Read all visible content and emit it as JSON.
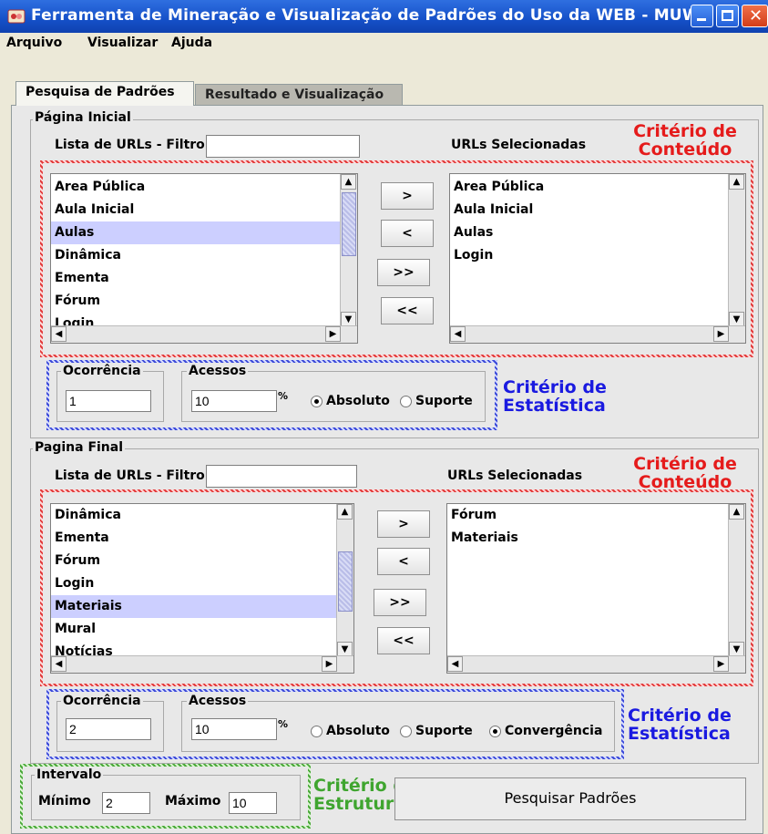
{
  "window": {
    "title": "Ferramenta de Mineração e Visualização de Padrões do Uso da WEB - MUW",
    "icon": "app-icon",
    "controls": [
      "minimize-icon",
      "maximize-icon",
      "close-icon"
    ]
  },
  "menu": [
    "Arquivo",
    "Visualizar",
    "Ajuda"
  ],
  "tabs": [
    {
      "label": "Pesquisa de Padrões",
      "active": true
    },
    {
      "label": "Resultado e Visualização",
      "active": false
    }
  ],
  "colors": {
    "red": "#e51b1b",
    "blue": "#1a1ae0",
    "green": "#3fa52f"
  },
  "inicial": {
    "group_label": "Página Inicial",
    "filter_label": "Lista de URLs - Filtro:",
    "filter_value": "",
    "selected_label": "URLs Selecionadas",
    "criterio_conteudo": [
      "Critério de",
      "Conteúdo"
    ],
    "available": [
      "Area Pública",
      "Aula Inicial",
      "Aulas",
      "Dinâmica",
      "Ementa",
      "Fórum",
      "Login"
    ],
    "available_selected": "Aulas",
    "selected": [
      "Area Pública",
      "Aula Inicial",
      "Aulas",
      "Login"
    ],
    "buttons": [
      ">",
      "<",
      ">>",
      "<<"
    ],
    "ocorrencia_label": "Ocorrência",
    "ocorrencia_value": "1",
    "acessos_label": "Acessos",
    "acessos_value": "10",
    "percent": "%",
    "radios": [
      {
        "label": "Absoluto",
        "checked": true
      },
      {
        "label": "Suporte",
        "checked": false
      }
    ],
    "criterio_estatistica": [
      "Critério de",
      "Estatística"
    ]
  },
  "final": {
    "group_label": "Pagina Final",
    "filter_label": "Lista de URLs - Filtro:",
    "filter_value": "",
    "selected_label": "URLs Selecionadas",
    "criterio_conteudo": [
      "Critério de",
      "Conteúdo"
    ],
    "available": [
      "Dinâmica",
      "Ementa",
      "Fórum",
      "Login",
      "Materiais",
      "Mural",
      "Notícias"
    ],
    "available_selected": "Materiais",
    "selected": [
      "Fórum",
      "Materiais"
    ],
    "buttons": [
      ">",
      "<",
      ">>",
      "<<"
    ],
    "ocorrencia_label": "Ocorrência",
    "ocorrencia_value": "2",
    "acessos_label": "Acessos",
    "acessos_value": "10",
    "percent": "%",
    "radios": [
      {
        "label": "Absoluto",
        "checked": false
      },
      {
        "label": "Suporte",
        "checked": false
      },
      {
        "label": "Convergência",
        "checked": true
      }
    ],
    "criterio_estatistica": [
      "Critério de",
      "Estatística"
    ]
  },
  "intervalo": {
    "label": "Intervalo",
    "minimo_label": "Mínimo",
    "minimo_value": "2",
    "maximo_label": "Máximo",
    "maximo_value": "10",
    "criterio_estrutura": [
      "Critério de",
      "Estrutura"
    ]
  },
  "search_button": "Pesquisar Padrões"
}
